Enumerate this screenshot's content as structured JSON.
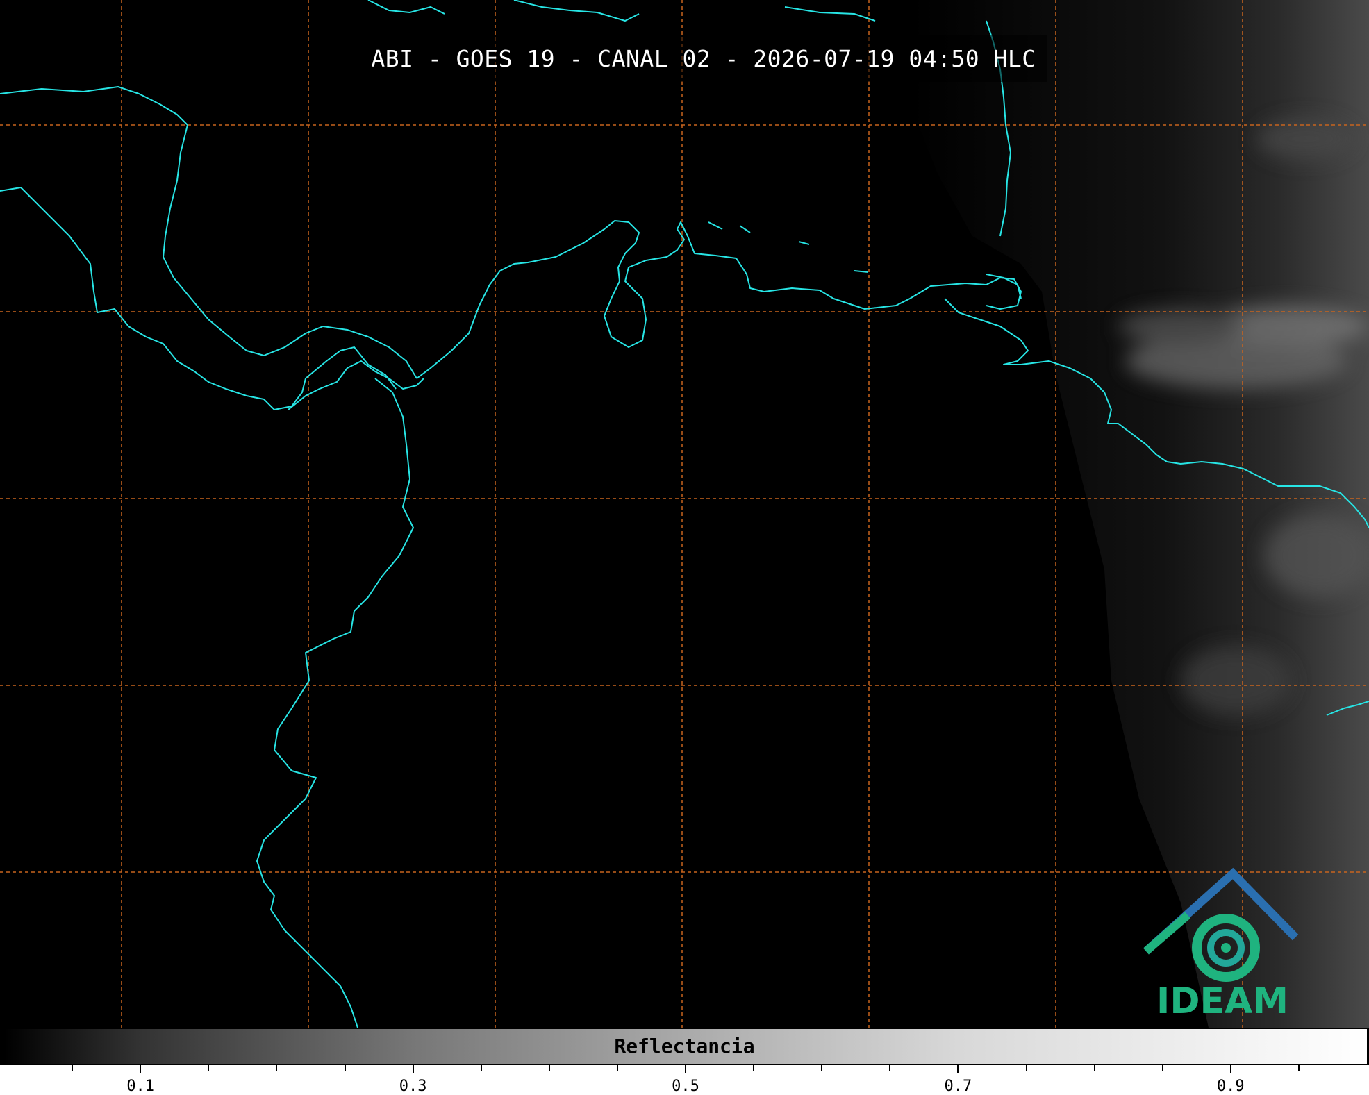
{
  "title": "ABI - GOES 19 - CANAL 02 - 2026-07-19 04:50 HLC",
  "logo": {
    "text": "IDEAM",
    "icon": "ideam-logo-icon"
  },
  "colorbar": {
    "label": "Reflectancia",
    "ticks": [
      "0.1",
      "0.3",
      "0.5",
      "0.7",
      "0.9"
    ]
  },
  "colors": {
    "coastline": "#27e5e5",
    "gridline": "#c8641e",
    "background": "#000000",
    "logo_blue": "#2a6fb0",
    "logo_green": "#1fb37f"
  },
  "map": {
    "type": "satellite-visible-reflectance",
    "graticule": "dashed"
  }
}
